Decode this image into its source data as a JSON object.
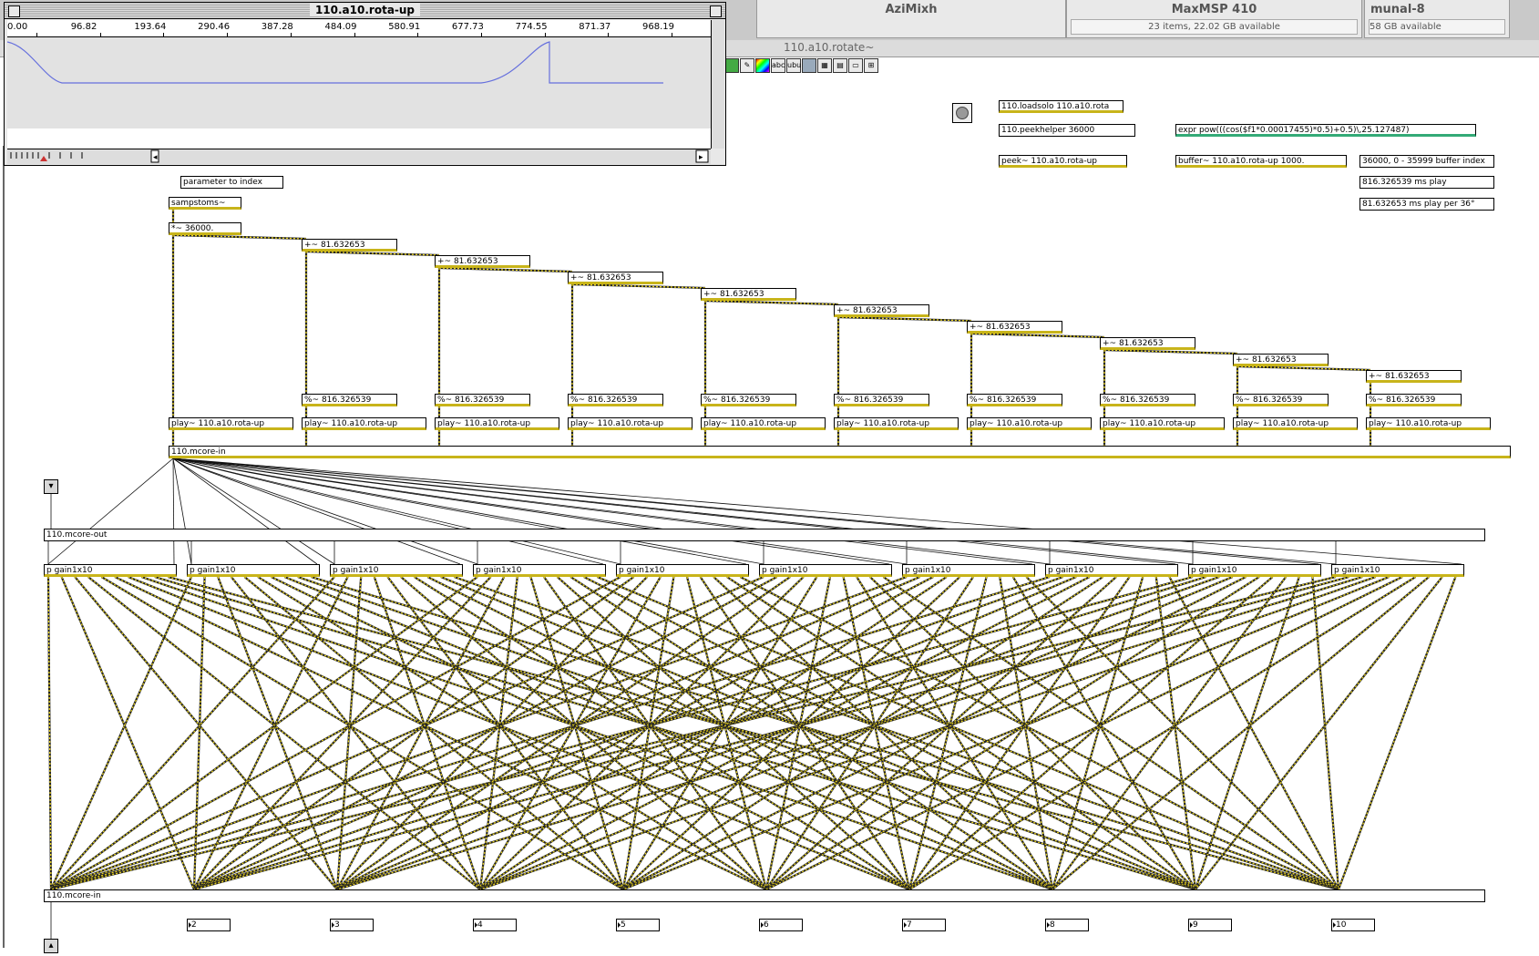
{
  "desktop": {
    "tabs": [
      {
        "title": "AziMixh",
        "sub": ""
      },
      {
        "title": "MaxMSP 410",
        "sub": "23 items, 22.02 GB available"
      },
      {
        "title": "munal-8",
        "sub": "58 GB available"
      }
    ]
  },
  "patcher": {
    "title": "110.a10.rotate~"
  },
  "toolbar": {
    "abc_label": "abc",
    "ubu_label": "ubu"
  },
  "buffer_window": {
    "title": "110.a10.rota-up",
    "ruler_ticks": [
      "0.00",
      "96.82",
      "193.64",
      "290.46",
      "387.28",
      "484.09",
      "580.91",
      "677.73",
      "774.55",
      "871.37",
      "968.19"
    ]
  },
  "objects": {
    "loadsolo": "110.loadsolo 110.a10.rota",
    "peekhelper": "110.peekhelper 36000",
    "expr": "expr pow(((cos($f1*0.00017455)*0.5)+0.5)\\,25.127487)",
    "peek": "peek~ 110.a10.rota-up",
    "buffer": "buffer~ 110.a10.rota-up 1000.",
    "comment_index": "36000, 0 - 35999 buffer index",
    "comment_play": "816.326539 ms play",
    "comment_per": "81.632653 ms play per 36°",
    "comment_param": "parameter to index",
    "sampstoms": "sampstoms~",
    "mult": "*~ 36000.",
    "plus_label": "+~ 81.632653",
    "mod_label": "%~ 816.326539",
    "play_label": "play~ 110.a10.rota-up",
    "mcore_in_top": "110.mcore-in",
    "mcore_out": "110.mcore-out",
    "gain_label": "p gain1x10",
    "mcore_in_bottom": "110.mcore-in",
    "numbers": [
      "2",
      "3",
      "4",
      "5",
      "6",
      "7",
      "8",
      "9",
      "10"
    ]
  }
}
